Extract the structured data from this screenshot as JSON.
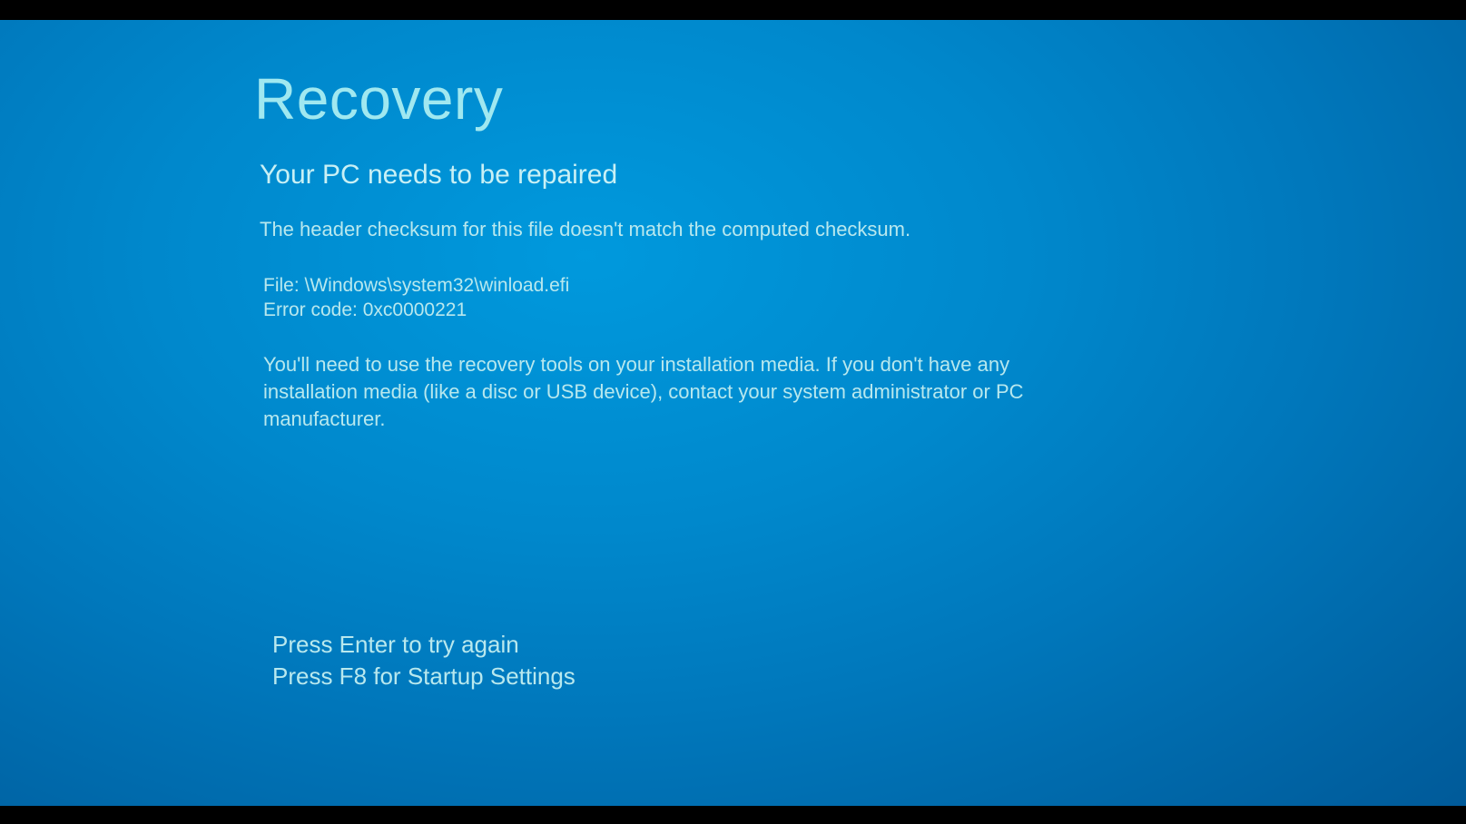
{
  "title": "Recovery",
  "subtitle": "Your PC needs to be repaired",
  "error_description": "The header checksum for this file doesn't match the computed checksum.",
  "file_line": "File: \\Windows\\system32\\winload.efi",
  "error_code_line": "Error code: 0xc0000221",
  "instructions": "You'll need to use the recovery tools on your installation media. If you don't have any installation media (like a disc or USB device), contact your system administrator or PC manufacturer.",
  "key_prompts": {
    "enter": "Press Enter to try again",
    "f8": "Press F8 for Startup Settings"
  }
}
